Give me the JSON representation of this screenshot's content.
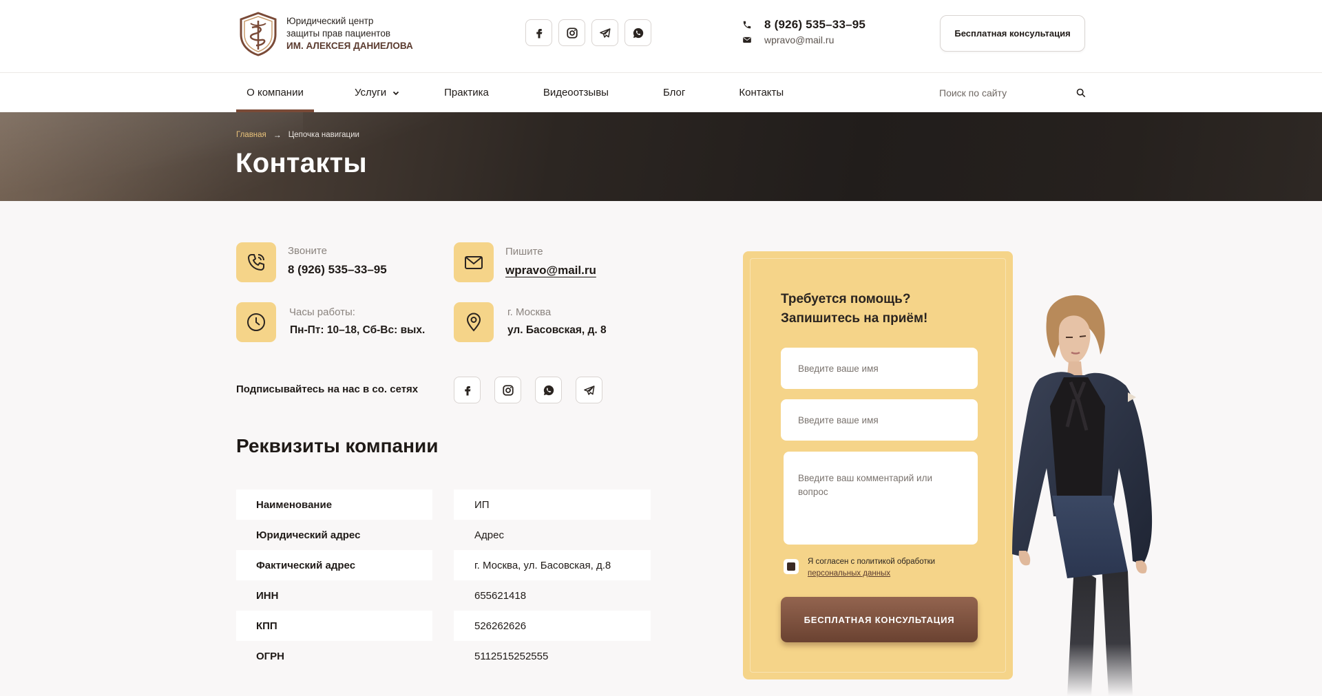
{
  "colors": {
    "accent": "#f5d489",
    "brand_brown": "#7a4a37",
    "text": "#1f1a17"
  },
  "header": {
    "logo": {
      "line1": "Юридический центр",
      "line2": "защиты прав пациентов",
      "line3": "ИМ. АЛЕКСЕЯ ДАНИЕЛОВА"
    },
    "socials": [
      "facebook-icon",
      "instagram-icon",
      "telegram-icon",
      "whatsapp-icon"
    ],
    "phone": "8 (926) 535–33–95",
    "email": "wpravo@mail.ru",
    "consult_button": "Бесплатная консультация"
  },
  "nav": {
    "items": [
      "О компании",
      "Услуги",
      "Практика",
      "Видеоотзывы",
      "Блог",
      "Контакты"
    ],
    "active_index": 0,
    "search_placeholder": "Поиск по сайту"
  },
  "hero": {
    "breadcrumb_home": "Главная",
    "breadcrumb_arrow": "→",
    "breadcrumb_current": "Цепочка навигации",
    "title": "Контакты"
  },
  "contacts": {
    "call_label": "Звоните",
    "call_value": "8 (926) 535–33–95",
    "write_label": "Пишите",
    "write_value": "wpravo@mail.ru",
    "hours_label": "Часы работы:",
    "hours_value": "Пн-Пт: 10–18, Сб-Вс: вых.",
    "city_label": "г. Москва",
    "address_value": "ул. Басовская, д. 8",
    "subscribe_label": "Подписывайтесь на нас в со. сетях",
    "socials": [
      "facebook-icon",
      "instagram-icon",
      "whatsapp-icon",
      "telegram-icon"
    ]
  },
  "requisites": {
    "title": "Реквизиты компании",
    "rows": [
      {
        "key": "Наименование",
        "value": "ИП"
      },
      {
        "key": "Юридический адрес",
        "value": "Адрес"
      },
      {
        "key": "Фактический адрес",
        "value": "г. Москва, ул. Басовская, д.8"
      },
      {
        "key": "ИНН",
        "value": "655621418"
      },
      {
        "key": "КПП",
        "value": "526262626"
      },
      {
        "key": "ОГРН",
        "value": "5112515252555"
      }
    ]
  },
  "form": {
    "title_line1": "Требуется помощь?",
    "title_line2": "Запишитесь на приём!",
    "name_placeholder_1": "Введите ваше имя",
    "name_placeholder_2": "Введите ваше имя",
    "comment_placeholder": "Введите ваш комментарий или вопрос",
    "consent_text": "Я согласен с политикой обработки",
    "consent_link": "персональных данных",
    "consent_checked": true,
    "submit": "БЕСПЛАТНАЯ КОНСУЛЬТАЦИЯ"
  }
}
